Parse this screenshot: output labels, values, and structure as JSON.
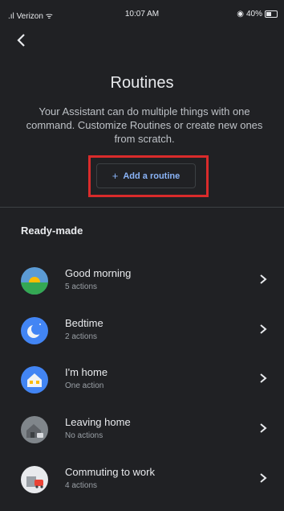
{
  "status": {
    "carrier": "Verizon",
    "time": "10:07 AM",
    "battery": "40%"
  },
  "page": {
    "title": "Routines",
    "description": "Your Assistant can do multiple things with one command. Customize Routines or create new ones from scratch."
  },
  "add_button": {
    "icon": "plus",
    "label": "Add a routine"
  },
  "section": {
    "title": "Ready-made"
  },
  "routines": [
    {
      "name": "Good morning",
      "actions": "5 actions",
      "icon": "sunrise-icon"
    },
    {
      "name": "Bedtime",
      "actions": "2 actions",
      "icon": "moon-icon"
    },
    {
      "name": "I'm home",
      "actions": "One action",
      "icon": "house-icon"
    },
    {
      "name": "Leaving home",
      "actions": "No actions",
      "icon": "leaving-home-icon"
    },
    {
      "name": "Commuting to work",
      "actions": "4 actions",
      "icon": "commute-icon"
    }
  ],
  "colors": {
    "accent": "#8ab4f8",
    "highlight": "#d92b2b",
    "background": "#202124"
  }
}
